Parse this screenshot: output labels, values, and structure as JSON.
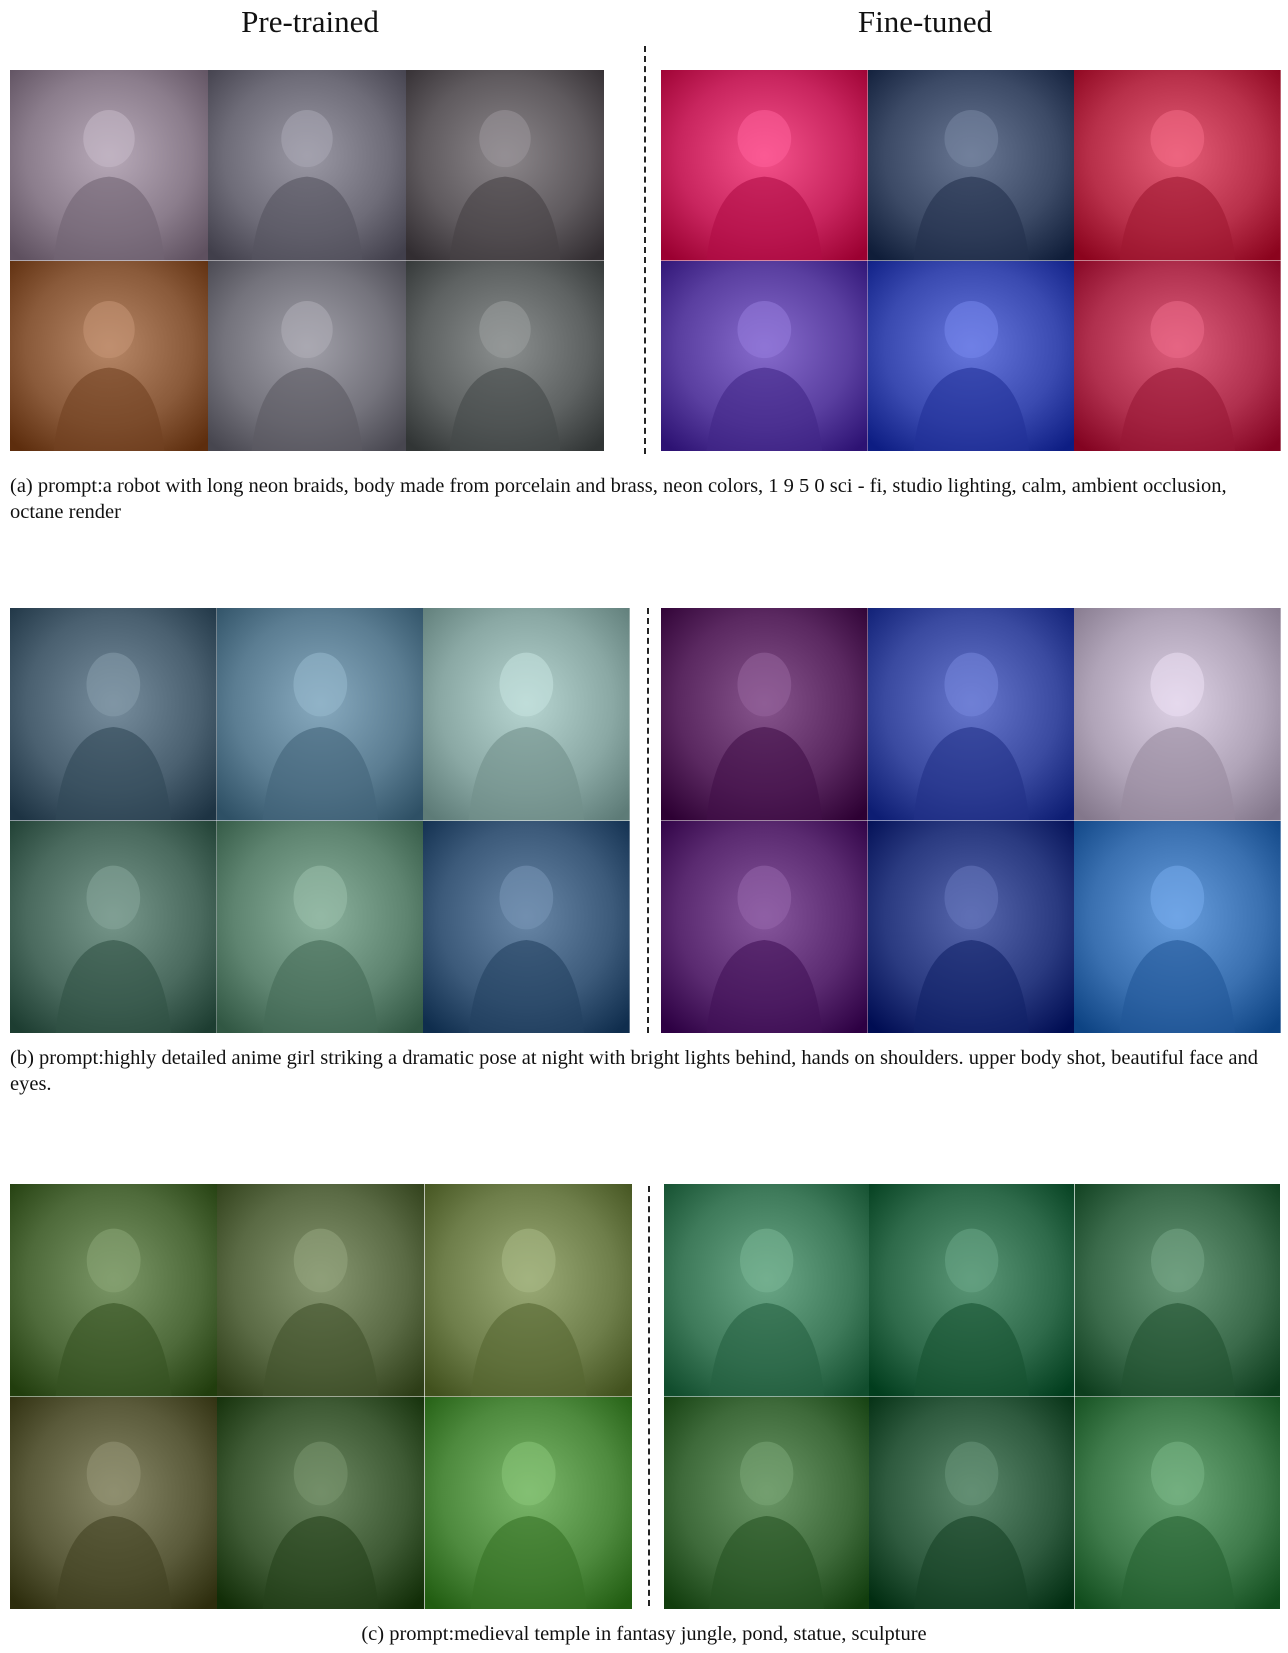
{
  "headings": {
    "pretrained": "Pre-trained",
    "finetuned": "Fine-tuned"
  },
  "panels": [
    {
      "caption": "(a) prompt:a robot with long neon braids, body made from porcelain and brass, neon colors, 1 9 5 0 sci - fi, studio lighting, calm, ambient occlusion, octane render",
      "pretrained_colors": [
        "#8b7d8c",
        "#6e6c78",
        "#5f5a5e",
        "#8a5a3a",
        "#74737c",
        "#5e6262"
      ],
      "finetuned_colors": [
        "#c8255e",
        "#3c4a66",
        "#b8304a",
        "#5a3fa0",
        "#3a4ab0",
        "#b0304e"
      ]
    },
    {
      "caption": "(b) prompt:highly detailed anime girl striking a dramatic pose at night with bright lights behind, hands on shoulders. upper body shot, beautiful face and eyes.",
      "pretrained_colors": [
        "#4a6070",
        "#5b7d92",
        "#8aa8a4",
        "#4a6a5e",
        "#5e8470",
        "#3c5a7a"
      ],
      "finetuned_colors": [
        "#5a2860",
        "#3a4aa0",
        "#b0a4b8",
        "#5a2a70",
        "#2a3a80",
        "#3a70b0"
      ]
    },
    {
      "caption": "(c) prompt:medieval temple in fantasy jungle, pond, statue, sculpture",
      "pretrained_colors": [
        "#4e6a3a",
        "#5a6a44",
        "#6e7e4a",
        "#5a5a3a",
        "#3e5a34",
        "#4e8a3e"
      ],
      "finetuned_colors": [
        "#3e7a5a",
        "#2e6a4a",
        "#3a6a4a",
        "#3e6a3a",
        "#2e5a3e",
        "#3e7a4a"
      ]
    }
  ]
}
